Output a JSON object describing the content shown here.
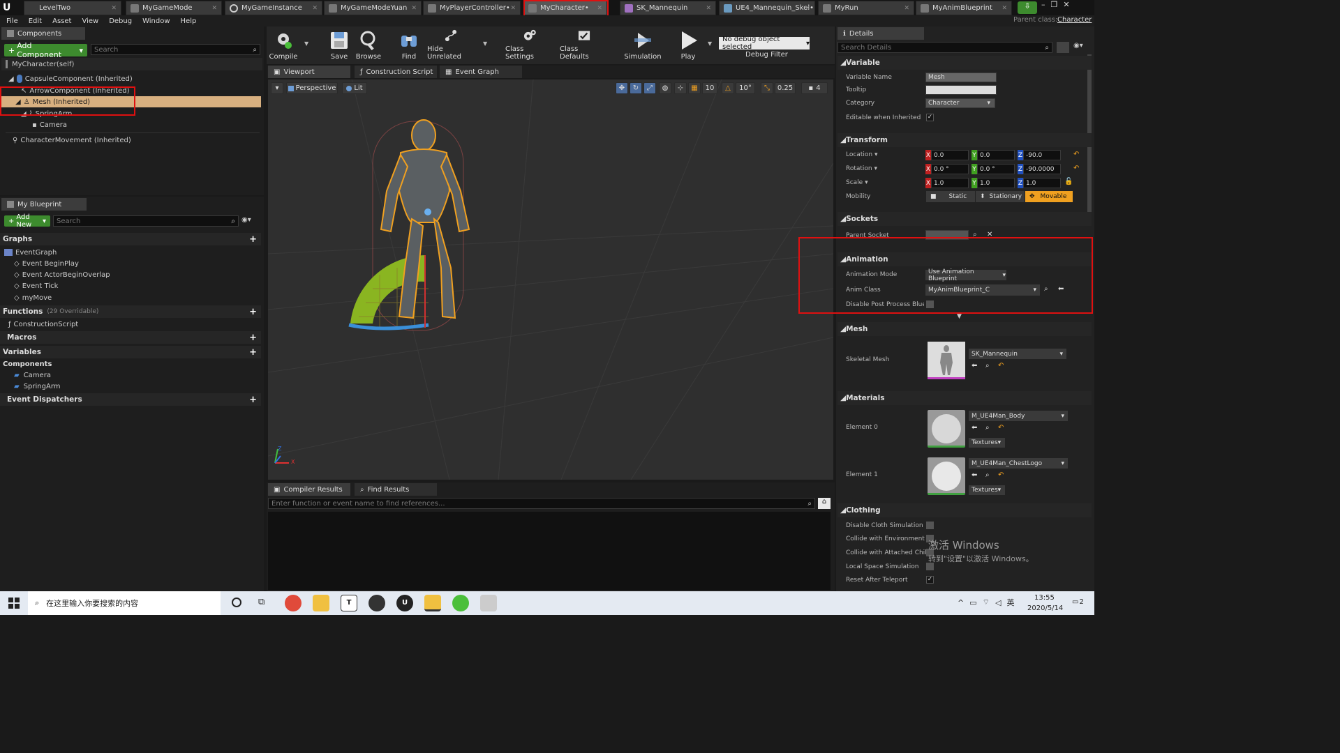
{
  "tabs": [
    {
      "label": "LevelTwo"
    },
    {
      "label": "MyGameMode"
    },
    {
      "label": "MyGameInstance"
    },
    {
      "label": "MyGameModeYuan"
    },
    {
      "label": "MyPlayerController•"
    },
    {
      "label": "MyCharacter•"
    },
    {
      "label": "SK_Mannequin"
    },
    {
      "label": "UE4_Mannequin_Skel•"
    },
    {
      "label": "MyRun"
    },
    {
      "label": "MyAnimBlueprint"
    }
  ],
  "parent_class": {
    "label": "Parent class:",
    "value": "Character"
  },
  "menu": [
    "File",
    "Edit",
    "Asset",
    "View",
    "Debug",
    "Window",
    "Help"
  ],
  "components": {
    "title": "Components",
    "add_label": "Add Component",
    "search_placeholder": "Search",
    "self_label": "MyCharacter(self)",
    "items": [
      "CapsuleComponent (Inherited)",
      "ArrowComponent (Inherited)",
      "Mesh (Inherited)",
      "SpringArm",
      "Camera",
      "CharacterMovement (Inherited)"
    ]
  },
  "blueprint": {
    "title": "My Blueprint",
    "add_label": "Add New",
    "search_placeholder": "Search",
    "graphs": "Graphs",
    "event_graph": "EventGraph",
    "events": [
      "Event BeginPlay",
      "Event ActorBeginOverlap",
      "Event Tick",
      "myMove"
    ],
    "functions": "Functions",
    "functions_count": "(29 Overridable)",
    "construction": "ConstructionScript",
    "macros": "Macros",
    "variables": "Variables",
    "comp_header": "Components",
    "comp_items": [
      "Camera",
      "SpringArm"
    ],
    "dispatchers": "Event Dispatchers"
  },
  "toolbar": {
    "compile": "Compile",
    "save": "Save",
    "browse": "Browse",
    "find": "Find",
    "hide_unrelated": "Hide Unrelated",
    "class_settings": "Class Settings",
    "class_defaults": "Class Defaults",
    "simulation": "Simulation",
    "play": "Play",
    "debug_select": "No debug object selected",
    "debug_filter": "Debug Filter"
  },
  "editor_tabs": [
    "Viewport",
    "Construction Script",
    "Event Graph"
  ],
  "viewport": {
    "perspective": "Perspective",
    "lit": "Lit",
    "grid": "10",
    "angle": "10°",
    "scale": "0.25",
    "cam_speed": "4",
    "axis_x": "X",
    "axis_z": "Z"
  },
  "bottom": {
    "tab1": "Compiler Results",
    "tab2": "Find Results",
    "find_placeholder": "Enter function or event name to find references..."
  },
  "details": {
    "title": "Details",
    "search_placeholder": "Search Details",
    "variable": {
      "header": "Variable",
      "name_label": "Variable Name",
      "name": "Mesh",
      "tooltip_label": "Tooltip",
      "category_label": "Category",
      "category": "Character",
      "editable_label": "Editable when Inherited"
    },
    "transform": {
      "header": "Transform",
      "location": "Location",
      "rotation": "Rotation",
      "scale": "Scale",
      "mobility": "Mobility",
      "loc": [
        "0.0",
        "0.0",
        "-90.0"
      ],
      "rot": [
        "0.0 °",
        "0.0 °",
        "-90.0000"
      ],
      "scl": [
        "1.0",
        "1.0",
        "1.0"
      ],
      "mob": [
        "Static",
        "Stationary",
        "Movable"
      ],
      "x": "X",
      "y": "Y",
      "z": "Z"
    },
    "sockets": {
      "header": "Sockets",
      "parent": "Parent Socket"
    },
    "animation": {
      "header": "Animation",
      "mode_label": "Animation Mode",
      "mode": "Use Animation Blueprint",
      "class_label": "Anim Class",
      "class": "MyAnimBlueprint_C",
      "disable_label": "Disable Post Process Blue"
    },
    "mesh": {
      "header": "Mesh",
      "label": "Skeletal Mesh",
      "value": "SK_Mannequin"
    },
    "materials": {
      "header": "Materials",
      "e0": "Element 0",
      "e0_value": "M_UE4Man_Body",
      "e1": "Element 1",
      "e1_value": "M_UE4Man_ChestLogo",
      "textures": "Textures"
    },
    "clothing": {
      "header": "Clothing",
      "items": [
        "Disable Cloth Simulation",
        "Collide with Environment",
        "Collide with Attached Child",
        "Local Space Simulation",
        "Reset After Teleport"
      ]
    }
  },
  "watermark": {
    "line1": "激活 Windows",
    "line2": "转到\"设置\"以激活 Windows。"
  },
  "taskbar": {
    "search": "在这里输入你要搜索的内容",
    "ime": "英",
    "time": "13:55",
    "date": "2020/5/14",
    "notif": "2"
  },
  "colors": {
    "accent_orange": "#f0a020",
    "green": "#3d8b2e",
    "red_box": "#e01010",
    "selection": "#d8b080"
  }
}
